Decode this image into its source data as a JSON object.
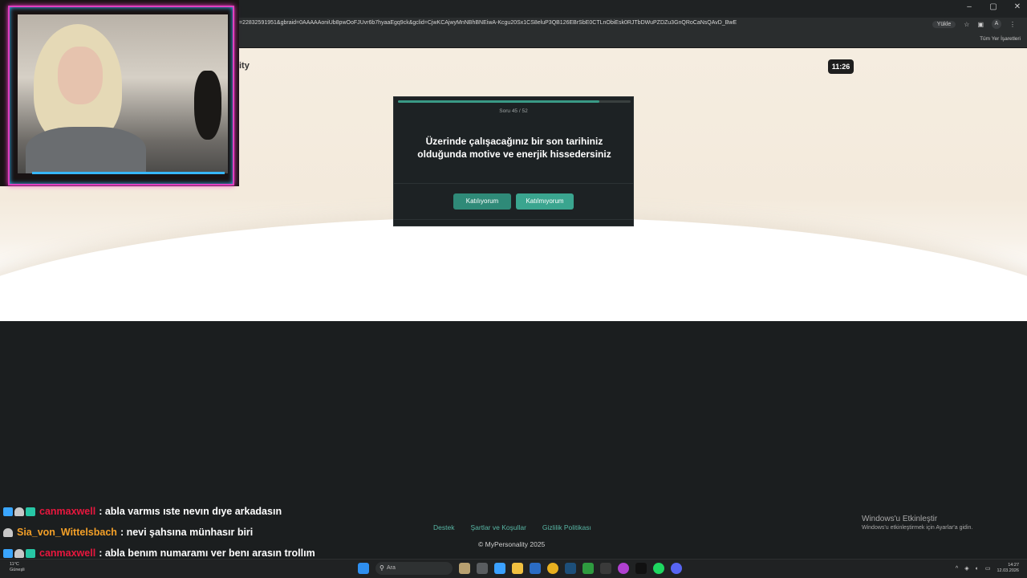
{
  "browser": {
    "url": "=22832591951&gbraid=0AAAAAoniUb8pwOoFJUvr6b7hyaaEgq9ck&gclid=CjwKCAjwyMnNBhBNEiwA-Kcgu20Sx1CS8eluP3QB126EBrSbE0CTLnObiEsk0RJTbDWuPZDZu3GnQRoCaNsQAvD_BwE",
    "update_label": "Yükle",
    "profile_initial": "A",
    "bookmarks_right": "Tüm Yer İşaretleri",
    "window_controls": [
      "–",
      "▢",
      "✕"
    ]
  },
  "page": {
    "brand_fragment": "ity",
    "timer": "11:26"
  },
  "quiz": {
    "progress": 0.865,
    "counter": "Soru 45 / 52",
    "question": "Üzerinde çalışacağınız bir son tarihiniz olduğunda motive ve enerjik hissedersiniz",
    "answers": [
      "Katılıyorum",
      "Katılmıyorum"
    ]
  },
  "chat": [
    {
      "user": "canmaxwell",
      "color": "#e8173e",
      "badges": [
        "blue",
        "gray",
        "teal"
      ],
      "message": ": abla varmıs ıste nevın dıye arkadasın"
    },
    {
      "user": "Sia_von_Wittelsbach",
      "color": "#f4a028",
      "badges": [
        "gray"
      ],
      "message": ": nevi şahsına münhasır biri"
    },
    {
      "user": "canmaxwell",
      "color": "#e8173e",
      "badges": [
        "blue",
        "gray",
        "teal"
      ],
      "message": ": abla benım numaramı ver benı arasın trollım"
    }
  ],
  "footer": {
    "links": [
      "Destek",
      "Şartlar ve Koşullar",
      "Gizlilik Politikası"
    ],
    "copyright": "© MyPersonality 2025"
  },
  "activation": {
    "title": "Windows'u Etkinleştir",
    "subtitle": "Windows'u etkinleştirmek için Ayarlar'a gidin."
  },
  "taskbar": {
    "weather_temp": "11°C",
    "weather_desc": "Güneşli",
    "search_placeholder": "Ara",
    "time": "14:27",
    "date": "12.03.2026"
  }
}
